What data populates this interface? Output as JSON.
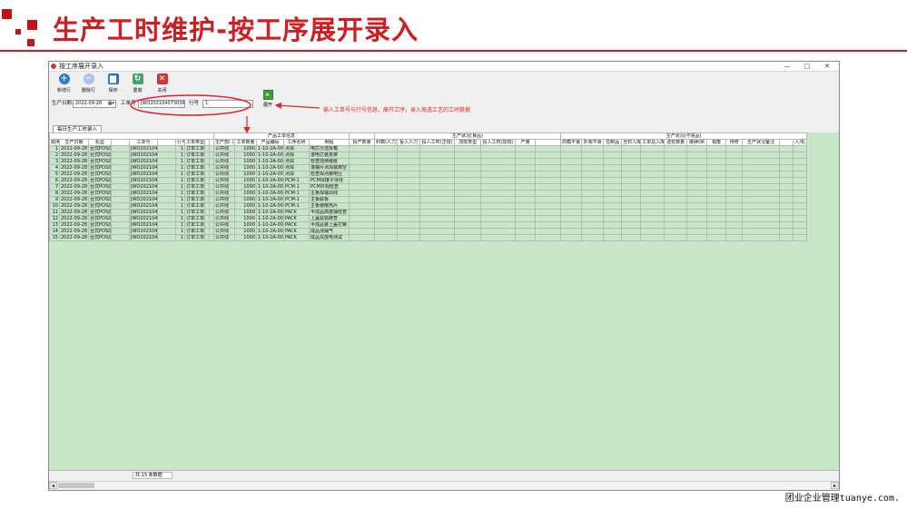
{
  "slide": {
    "title": "生产工时维护-按工序展开录入",
    "watermark": "团业企业管理tuanye.com."
  },
  "window": {
    "title": "按工序展开录入",
    "controls": [
      "—",
      "□",
      "✕"
    ]
  },
  "toolbar": [
    {
      "label": "新增行",
      "icon": "add-icon",
      "color": "#2a7fd4",
      "glyph": "+"
    },
    {
      "label": "删除行",
      "icon": "remove-icon",
      "color": "#a9c4e6",
      "glyph": "−"
    },
    {
      "label": "保存",
      "icon": "save-icon",
      "color": "#2f6fc0",
      "glyph": "▆"
    },
    {
      "label": "重做",
      "icon": "redo-icon",
      "color": "#47a36e",
      "glyph": "↻"
    },
    {
      "label": "关闭",
      "icon": "close-icon",
      "color": "#d43434",
      "glyph": "✕"
    }
  ],
  "query": {
    "date_label": "生产日期",
    "date_value": "2022-09-28",
    "order_label": "工单号",
    "order_value": "JWO202104073036",
    "line_label": "行号",
    "line_value": "1",
    "expand_label": "展开"
  },
  "annotation": "输入工单号与行号信息，展开工序，录入每道工艺的工时数据",
  "tab": "每日生产工时录入",
  "grid": {
    "groups": [
      {
        "label": "",
        "span": 10
      },
      {
        "label": "产品工单信息",
        "span": 5
      },
      {
        "label": "",
        "span": 1
      },
      {
        "label": "生产状况(良品)",
        "span": 7
      },
      {
        "label": "生产状况(不良品)",
        "span": 12
      }
    ],
    "columns": [
      "顺序",
      "生产日期",
      "机型",
      "",
      "工单号",
      "",
      "行号",
      "工单类型",
      "",
      "",
      "生产部门",
      "工单数量",
      "产品编码",
      "工序名称",
      "制程",
      "投产数量",
      "料截(人力)",
      "投入人力",
      "投入工时(正班)",
      "加班类型",
      "投入工时(加班)",
      "产量",
      "",
      "的截不良",
      "外观不良",
      "在制品",
      "当日入库",
      "工单总入库",
      "送检数量",
      "继续OK",
      "报废",
      "待修",
      "生产状况备注",
      "",
      "人/机"
    ],
    "rows": [
      [
        "1",
        "2022-09-28",
        "台式POS成品(V1)",
        "JWO202104073036",
        "1",
        "订单工单",
        "公共线",
        "1000",
        "1-10-2A-006",
        "点焊",
        "电芯分选拆箱"
      ],
      [
        "2",
        "2022-09-28",
        "台式POS成品(V1)",
        "JWO202104073036",
        "1",
        "订单工单",
        "公共线",
        "1000",
        "1-10-2A-006",
        "点焊",
        "滚电芯装夹架"
      ],
      [
        "3",
        "2022-09-28",
        "台式POS成品(V1)",
        "JWO202104073036",
        "1",
        "订单工单",
        "公共线",
        "1000",
        "1-10-2A-006",
        "点焊",
        "检查陆续缝纸"
      ],
      [
        "4",
        "2022-09-28",
        "台式POS成品(V1)",
        "JWO202104073036",
        "1",
        "订单工单",
        "公共线",
        "1000",
        "1-10-2A-006",
        "点焊",
        "滚镍片点焊装离空"
      ],
      [
        "5",
        "2022-09-28",
        "台式POS成品(V1)",
        "JWO202104073036",
        "1",
        "订单工单",
        "公共线",
        "1000",
        "1-10-2A-006",
        "点焊",
        "检查焊点脚电压"
      ],
      [
        "6",
        "2022-09-28",
        "台式POS成品(V1)",
        "JWO202104073036",
        "1",
        "订单工单",
        "公共线",
        "1000",
        "1-10-2A-006",
        "PCM-1",
        "PCM焊接子母线"
      ],
      [
        "7",
        "2022-09-28",
        "台式POS成品(V1)",
        "JWO202104073036",
        "1",
        "订单工单",
        "公共线",
        "1000",
        "1-10-2A-006",
        "PCM-1",
        "PCM外观检查"
      ],
      [
        "8",
        "2022-09-28",
        "台式POS成品(V1)",
        "JWO202104073036",
        "1",
        "订单工单",
        "公共线",
        "1000",
        "1-10-2A-006",
        "PCM-1",
        "主板焊输出线"
      ],
      [
        "9",
        "2022-09-28",
        "台式POS成品(V1)",
        "JWO202104073036",
        "1",
        "订单工单",
        "公共线",
        "1000",
        "1-10-2A-006",
        "PCM-1",
        "主板联板"
      ],
      [
        "10",
        "2022-09-28",
        "台式POS成品(V1)",
        "JWO202104073036",
        "1",
        "订单工单",
        "公共线",
        "1000",
        "1-10-2A-006",
        "PCM-1",
        "主板装散热片"
      ],
      [
        "11",
        "2022-09-28",
        "台式POS成品(V1)",
        "JWO202104073036",
        "1",
        "订单工单",
        "公共线",
        "1000",
        "1-10-2A-006",
        "PACK",
        "半成品高度抽检查"
      ],
      [
        "12",
        "2022-09-28",
        "台式POS成品(V1)",
        "JWO202104073036",
        "1",
        "订单工单",
        "公共线",
        "1000",
        "1-10-2A-006",
        "PACK",
        "上盖贴铭牌查"
      ],
      [
        "13",
        "2022-09-28",
        "台式POS成品(V1)",
        "JWO202104073036",
        "1",
        "订单工单",
        "公共线",
        "1000",
        "1-10-2A-006",
        "PACK",
        "半成品装上盖打螺"
      ],
      [
        "14",
        "2022-09-28",
        "台式POS成品(V1)",
        "JWO202104073036",
        "1",
        "订单工单",
        "公共线",
        "1000",
        "1-10-2A-006",
        "PACK",
        "成品测漏气"
      ],
      [
        "15",
        "2022-09-28",
        "台式POS成品(V1)",
        "JWO202104073036",
        "1",
        "订单工单",
        "公共线",
        "1000",
        "1-10-2A-006",
        "PACK",
        "成品充放电测试"
      ]
    ]
  },
  "status": "共:15 条数据",
  "scroll": {
    "left": "◂",
    "right": "▸"
  }
}
